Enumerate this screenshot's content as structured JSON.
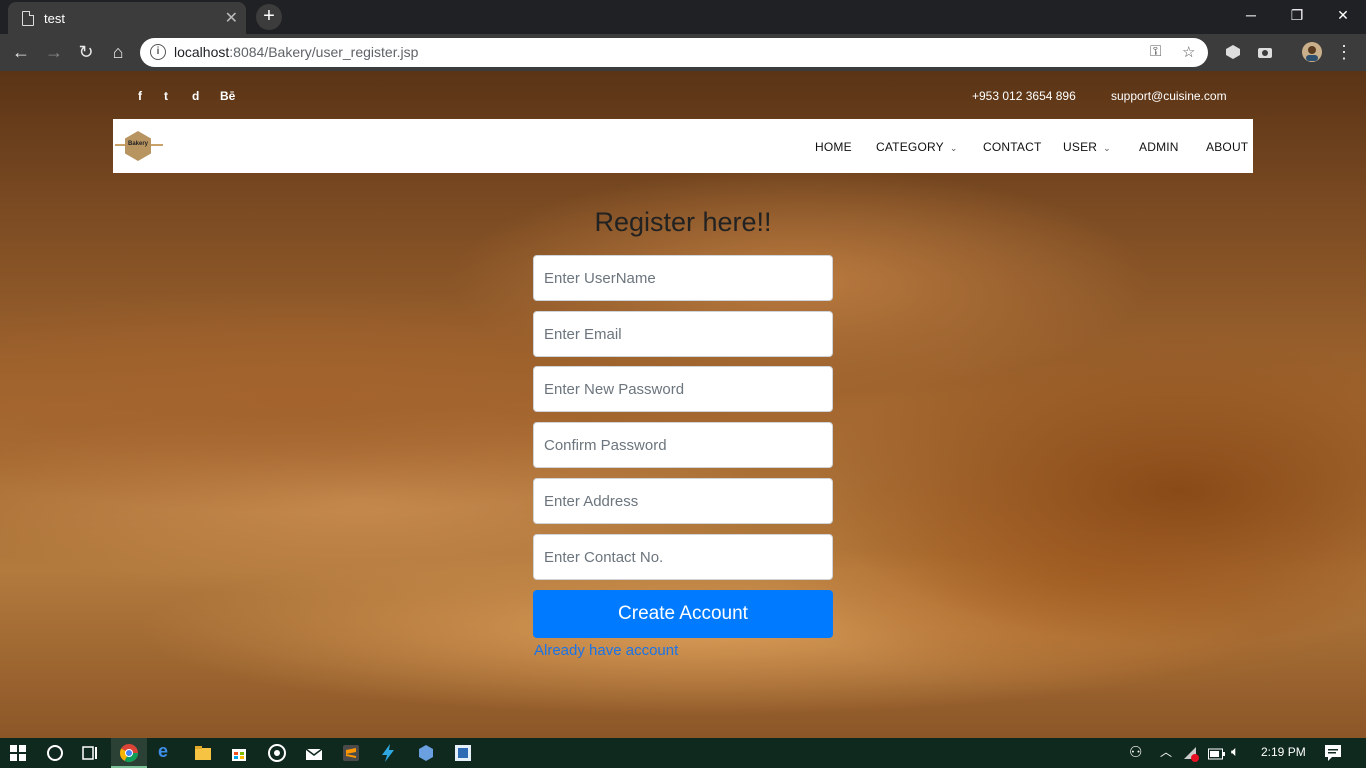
{
  "browser": {
    "tab_title": "test",
    "url_host": "localhost",
    "url_rest": ":8084/Bakery/user_register.jsp",
    "window_controls": [
      "minimize-icon",
      "maximize-icon",
      "close-icon"
    ]
  },
  "topbar": {
    "social": [
      "f",
      "t",
      "d",
      "Bē"
    ],
    "phone": "+953 012 3654 896",
    "email": "support@cuisine.com"
  },
  "navbar": {
    "logo_text": "Bakery",
    "items": [
      {
        "label": "HOME"
      },
      {
        "label": "CATEGORY",
        "dropdown": true
      },
      {
        "label": "CONTACT"
      },
      {
        "label": "USER",
        "dropdown": true
      },
      {
        "label": "ADMIN"
      },
      {
        "label": "ABOUT"
      }
    ]
  },
  "form": {
    "title": "Register here!!",
    "fields": [
      {
        "placeholder": "Enter UserName",
        "value": ""
      },
      {
        "placeholder": "Enter Email",
        "value": ""
      },
      {
        "placeholder": "Enter New Password",
        "value": ""
      },
      {
        "placeholder": "Confirm Password",
        "value": ""
      },
      {
        "placeholder": "Enter Address",
        "value": ""
      },
      {
        "placeholder": "Enter Contact No.",
        "value": ""
      }
    ],
    "submit_label": "Create Account",
    "login_link": "Already have account"
  },
  "taskbar": {
    "clock": "2:19 PM",
    "colors": {
      "accent_button": "#007bff",
      "taskbar": "#10291f"
    }
  }
}
